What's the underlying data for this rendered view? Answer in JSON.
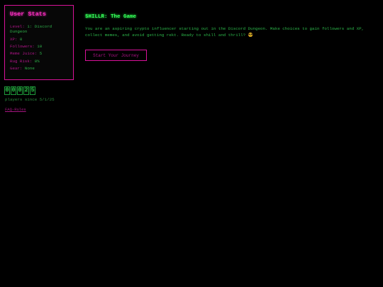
{
  "stats": {
    "title": "User Stats",
    "rows": [
      {
        "label": "Level:",
        "value": "1: Discord Dungeon"
      },
      {
        "label": "XP:",
        "value": "0"
      },
      {
        "label": "Followers:",
        "value": "10"
      },
      {
        "label": "Meme Juice:",
        "value": "5"
      },
      {
        "label": "Rug Risk:",
        "value": "0%"
      },
      {
        "label": "Gear:",
        "value": "None"
      }
    ]
  },
  "counter": {
    "digits": [
      "0",
      "0",
      "0",
      "2",
      "5"
    ],
    "caption": "players since 5/1/25"
  },
  "faq": {
    "label": "FAQ-Rules"
  },
  "game": {
    "title": "$HILLR: The Game",
    "description": "You are an aspiring crypto influencer starting out in the Discord Dungeon. Make choices to gain followers and XP, collect memes, and avoid getting rekt. Ready to shill and thrill? 😎",
    "start_label": "Start Your Journey"
  },
  "colors": {
    "background": "#000000",
    "accent_pink": "#d9129a",
    "accent_green": "#2fd44f"
  }
}
